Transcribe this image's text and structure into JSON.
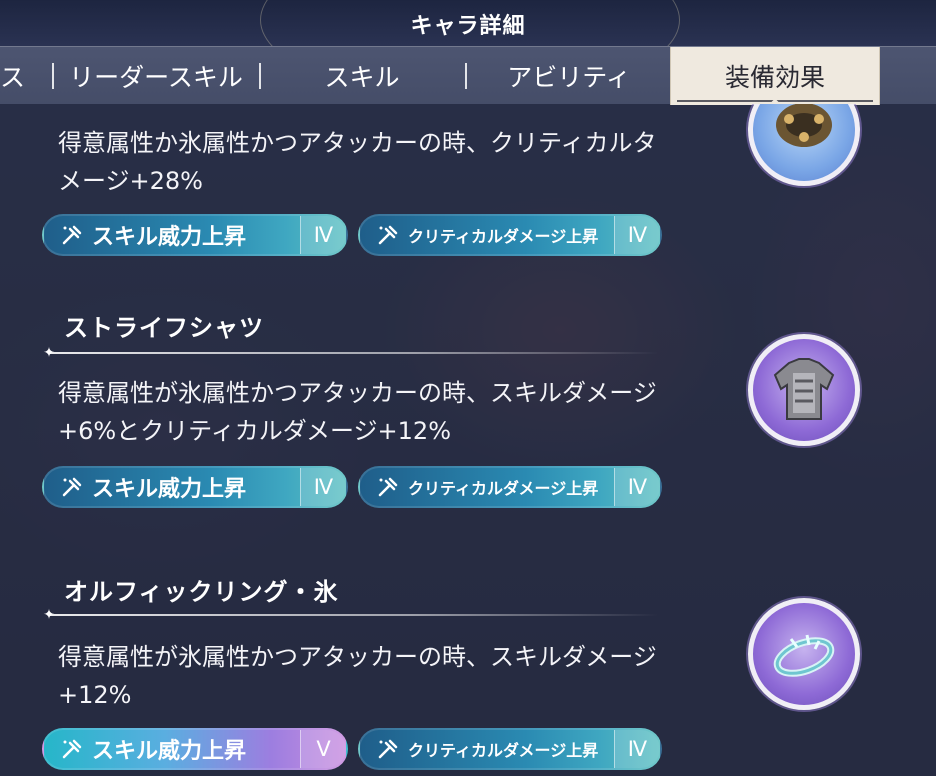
{
  "header": {
    "title": "キャラ詳細"
  },
  "tabs": [
    {
      "label": "ス",
      "active": false
    },
    {
      "label": "リーダースキル",
      "active": false
    },
    {
      "label": "スキル",
      "active": false
    },
    {
      "label": "アビリティ",
      "active": false
    },
    {
      "label": "装備効果",
      "active": true
    }
  ],
  "equipment": [
    {
      "name": "",
      "description_lines": [
        "得意属性か氷属性かつアタッカーの時、クリティカルタ",
        "メージ+28%"
      ],
      "icon": "bracelet-icon",
      "skills": [
        {
          "label": "スキル威力上昇",
          "level": "Ⅳ",
          "style": "blue"
        },
        {
          "label": "クリティカルダメージ上昇",
          "level": "Ⅳ",
          "style": "blue"
        }
      ]
    },
    {
      "name": "ストライフシャツ",
      "description_lines": [
        "得意属性が氷属性かつアタッカーの時、スキルダメージ",
        "+6%とクリティカルダメージ+12%"
      ],
      "icon": "shirt-icon",
      "skills": [
        {
          "label": "スキル威力上昇",
          "level": "Ⅳ",
          "style": "blue"
        },
        {
          "label": "クリティカルダメージ上昇",
          "level": "Ⅳ",
          "style": "blue"
        }
      ]
    },
    {
      "name": "オルフィックリング・氷",
      "description_lines": [
        "得意属性が氷属性かつアタッカーの時、スキルダメージ",
        "+12%"
      ],
      "icon": "ring-icon",
      "skills": [
        {
          "label": "スキル威力上昇",
          "level": "Ⅴ",
          "style": "purple"
        },
        {
          "label": "クリティカルダメージ上昇",
          "level": "Ⅳ",
          "style": "blue"
        }
      ]
    }
  ],
  "colors": {
    "active_tab": "#efe9df",
    "pill_blue": "#2a8ab2",
    "pill_purple": "#9c7ee0"
  }
}
